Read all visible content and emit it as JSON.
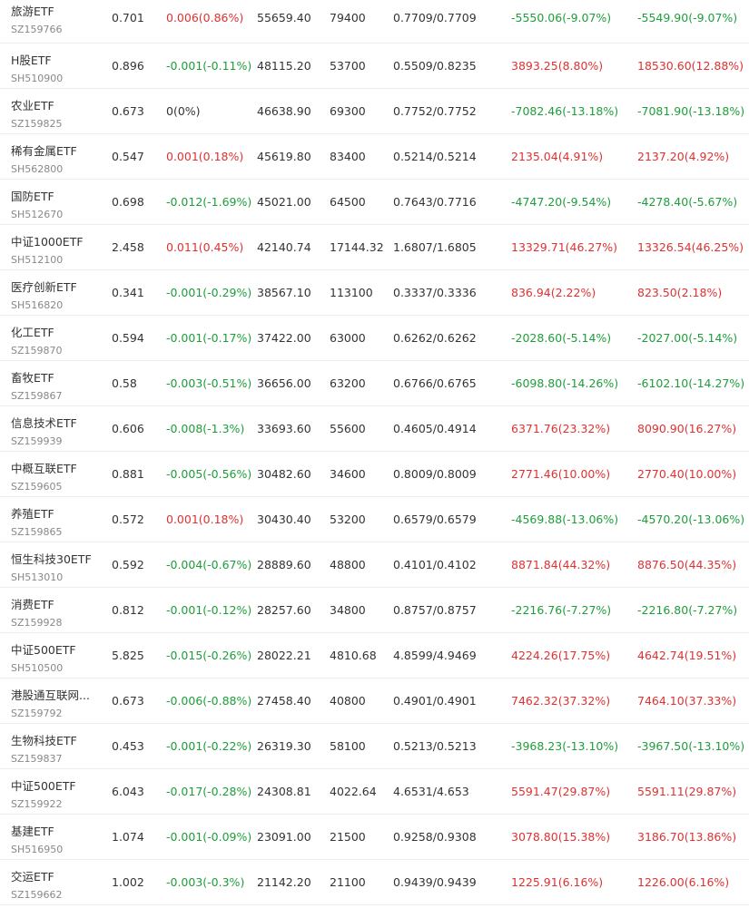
{
  "colors": {
    "up": "#e03131",
    "down": "#1e9e3a",
    "flat": "#333333"
  },
  "rows": [
    {
      "name": "旅游ETF",
      "code": "SZ159766",
      "price": "0.701",
      "change": "0.006(0.86%)",
      "change_dir": "up",
      "amount": "55659.40",
      "shares": "79400",
      "cost": "0.7709/0.7709",
      "pl1": "-5550.06(-9.07%)",
      "pl1_dir": "down",
      "pl2": "-5549.90(-9.07%)",
      "pl2_dir": "down"
    },
    {
      "name": "H股ETF",
      "code": "SH510900",
      "price": "0.896",
      "change": "-0.001(-0.11%)",
      "change_dir": "down",
      "amount": "48115.20",
      "shares": "53700",
      "cost": "0.5509/0.8235",
      "pl1": "3893.25(8.80%)",
      "pl1_dir": "up",
      "pl2": "18530.60(12.88%)",
      "pl2_dir": "up"
    },
    {
      "name": "农业ETF",
      "code": "SZ159825",
      "price": "0.673",
      "change": "0(0%)",
      "change_dir": "flat",
      "amount": "46638.90",
      "shares": "69300",
      "cost": "0.7752/0.7752",
      "pl1": "-7082.46(-13.18%)",
      "pl1_dir": "down",
      "pl2": "-7081.90(-13.18%)",
      "pl2_dir": "down"
    },
    {
      "name": "稀有金属ETF",
      "code": "SH562800",
      "price": "0.547",
      "change": "0.001(0.18%)",
      "change_dir": "up",
      "amount": "45619.80",
      "shares": "83400",
      "cost": "0.5214/0.5214",
      "pl1": "2135.04(4.91%)",
      "pl1_dir": "up",
      "pl2": "2137.20(4.92%)",
      "pl2_dir": "up"
    },
    {
      "name": "国防ETF",
      "code": "SH512670",
      "price": "0.698",
      "change": "-0.012(-1.69%)",
      "change_dir": "down",
      "amount": "45021.00",
      "shares": "64500",
      "cost": "0.7643/0.7716",
      "pl1": "-4747.20(-9.54%)",
      "pl1_dir": "down",
      "pl2": "-4278.40(-5.67%)",
      "pl2_dir": "down"
    },
    {
      "name": "中证1000ETF",
      "code": "SH512100",
      "price": "2.458",
      "change": "0.011(0.45%)",
      "change_dir": "up",
      "amount": "42140.74",
      "shares": "17144.32",
      "cost": "1.6807/1.6805",
      "pl1": "13329.71(46.27%)",
      "pl1_dir": "up",
      "pl2": "13326.54(46.25%)",
      "pl2_dir": "up"
    },
    {
      "name": "医疗创新ETF",
      "code": "SH516820",
      "price": "0.341",
      "change": "-0.001(-0.29%)",
      "change_dir": "down",
      "amount": "38567.10",
      "shares": "113100",
      "cost": "0.3337/0.3336",
      "pl1": "836.94(2.22%)",
      "pl1_dir": "up",
      "pl2": "823.50(2.18%)",
      "pl2_dir": "up"
    },
    {
      "name": "化工ETF",
      "code": "SZ159870",
      "price": "0.594",
      "change": "-0.001(-0.17%)",
      "change_dir": "down",
      "amount": "37422.00",
      "shares": "63000",
      "cost": "0.6262/0.6262",
      "pl1": "-2028.60(-5.14%)",
      "pl1_dir": "down",
      "pl2": "-2027.00(-5.14%)",
      "pl2_dir": "down"
    },
    {
      "name": "畜牧ETF",
      "code": "SZ159867",
      "price": "0.58",
      "change": "-0.003(-0.51%)",
      "change_dir": "down",
      "amount": "36656.00",
      "shares": "63200",
      "cost": "0.6766/0.6765",
      "pl1": "-6098.80(-14.26%)",
      "pl1_dir": "down",
      "pl2": "-6102.10(-14.27%)",
      "pl2_dir": "down"
    },
    {
      "name": "信息技术ETF",
      "code": "SZ159939",
      "price": "0.606",
      "change": "-0.008(-1.3%)",
      "change_dir": "down",
      "amount": "33693.60",
      "shares": "55600",
      "cost": "0.4605/0.4914",
      "pl1": "6371.76(23.32%)",
      "pl1_dir": "up",
      "pl2": "8090.90(16.27%)",
      "pl2_dir": "up"
    },
    {
      "name": "中概互联ETF",
      "code": "SZ159605",
      "price": "0.881",
      "change": "-0.005(-0.56%)",
      "change_dir": "down",
      "amount": "30482.60",
      "shares": "34600",
      "cost": "0.8009/0.8009",
      "pl1": "2771.46(10.00%)",
      "pl1_dir": "up",
      "pl2": "2770.40(10.00%)",
      "pl2_dir": "up"
    },
    {
      "name": "养殖ETF",
      "code": "SZ159865",
      "price": "0.572",
      "change": "0.001(0.18%)",
      "change_dir": "up",
      "amount": "30430.40",
      "shares": "53200",
      "cost": "0.6579/0.6579",
      "pl1": "-4569.88(-13.06%)",
      "pl1_dir": "down",
      "pl2": "-4570.20(-13.06%)",
      "pl2_dir": "down"
    },
    {
      "name": "恒生科技30ETF",
      "code": "SH513010",
      "price": "0.592",
      "change": "-0.004(-0.67%)",
      "change_dir": "down",
      "amount": "28889.60",
      "shares": "48800",
      "cost": "0.4101/0.4102",
      "pl1": "8871.84(44.32%)",
      "pl1_dir": "up",
      "pl2": "8876.50(44.35%)",
      "pl2_dir": "up"
    },
    {
      "name": "消费ETF",
      "code": "SZ159928",
      "price": "0.812",
      "change": "-0.001(-0.12%)",
      "change_dir": "down",
      "amount": "28257.60",
      "shares": "34800",
      "cost": "0.8757/0.8757",
      "pl1": "-2216.76(-7.27%)",
      "pl1_dir": "down",
      "pl2": "-2216.80(-7.27%)",
      "pl2_dir": "down"
    },
    {
      "name": "中证500ETF",
      "code": "SH510500",
      "price": "5.825",
      "change": "-0.015(-0.26%)",
      "change_dir": "down",
      "amount": "28022.21",
      "shares": "4810.68",
      "cost": "4.8599/4.9469",
      "pl1": "4224.26(17.75%)",
      "pl1_dir": "up",
      "pl2": "4642.74(19.51%)",
      "pl2_dir": "up"
    },
    {
      "name": "港股通互联网...",
      "code": "SZ159792",
      "price": "0.673",
      "change": "-0.006(-0.88%)",
      "change_dir": "down",
      "amount": "27458.40",
      "shares": "40800",
      "cost": "0.4901/0.4901",
      "pl1": "7462.32(37.32%)",
      "pl1_dir": "up",
      "pl2": "7464.10(37.33%)",
      "pl2_dir": "up"
    },
    {
      "name": "生物科技ETF",
      "code": "SZ159837",
      "price": "0.453",
      "change": "-0.001(-0.22%)",
      "change_dir": "down",
      "amount": "26319.30",
      "shares": "58100",
      "cost": "0.5213/0.5213",
      "pl1": "-3968.23(-13.10%)",
      "pl1_dir": "down",
      "pl2": "-3967.50(-13.10%)",
      "pl2_dir": "down"
    },
    {
      "name": "中证500ETF",
      "code": "SZ159922",
      "price": "6.043",
      "change": "-0.017(-0.28%)",
      "change_dir": "down",
      "amount": "24308.81",
      "shares": "4022.64",
      "cost": "4.6531/4.653",
      "pl1": "5591.47(29.87%)",
      "pl1_dir": "up",
      "pl2": "5591.11(29.87%)",
      "pl2_dir": "up"
    },
    {
      "name": "基建ETF",
      "code": "SH516950",
      "price": "1.074",
      "change": "-0.001(-0.09%)",
      "change_dir": "down",
      "amount": "23091.00",
      "shares": "21500",
      "cost": "0.9258/0.9308",
      "pl1": "3078.80(15.38%)",
      "pl1_dir": "up",
      "pl2": "3186.70(13.86%)",
      "pl2_dir": "up"
    },
    {
      "name": "交运ETF",
      "code": "SZ159662",
      "price": "1.002",
      "change": "-0.003(-0.3%)",
      "change_dir": "down",
      "amount": "21142.20",
      "shares": "21100",
      "cost": "0.9439/0.9439",
      "pl1": "1225.91(6.16%)",
      "pl1_dir": "up",
      "pl2": "1226.00(6.16%)",
      "pl2_dir": "up"
    }
  ]
}
